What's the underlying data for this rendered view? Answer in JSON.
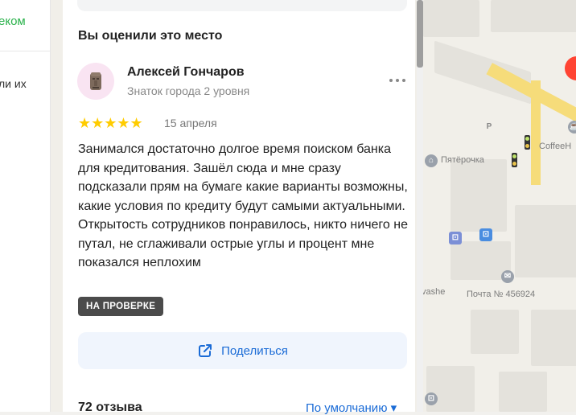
{
  "left_strip": {
    "line1": "еком",
    "line2": "ли их"
  },
  "review_section": {
    "title": "Вы оценили это место"
  },
  "review": {
    "author_name": "Алексей Гончаров",
    "author_level": "Знаток города 2 уровня",
    "rating": 5,
    "stars_display": "★★★★★",
    "date": "15 апреля",
    "text": "Занимался достаточно долгое время поиском банка для кредитования. Зашёл сюда и мне сразу подсказали прям на бумаге какие варианты возможны, какие условия по кредиту будут самыми актуальными. Открытость сотрудников понравилось, никто ничего не путал, не сглаживали острые углы и процент мне показался неплохим",
    "status_badge": "НА ПРОВЕРКЕ"
  },
  "share": {
    "label": "Поделиться",
    "icon": "share-icon"
  },
  "reviews_footer": {
    "count": "72 отзыва",
    "sort": "По умолчанию ▾"
  },
  "map": {
    "labels": {
      "pyaterochka": "Пятёрочка",
      "coffee": "CoffeeH",
      "post": "Почта № 456924",
      "vashe": "vashe"
    }
  },
  "colors": {
    "accent": "#1a6bd6",
    "star": "#ffcc00",
    "badge_bg": "#4b4b4b",
    "green": "#2bb24c"
  }
}
